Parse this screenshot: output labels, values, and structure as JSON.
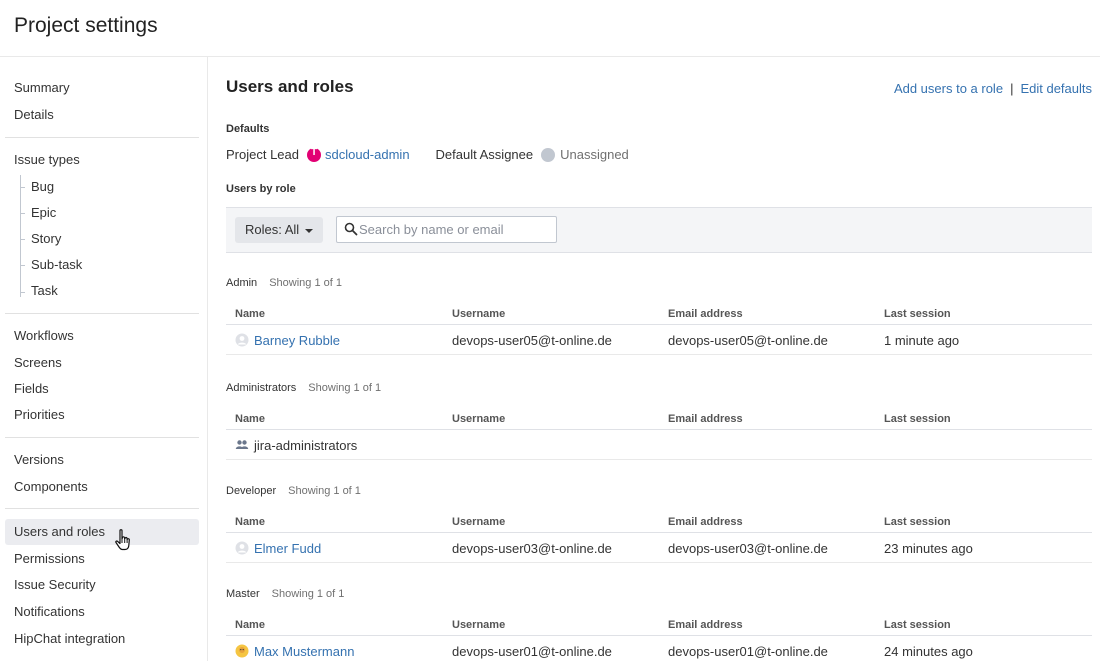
{
  "page_title": "Project settings",
  "sidebar": {
    "groups": [
      {
        "items": [
          {
            "label": "Summary"
          },
          {
            "label": "Details"
          }
        ]
      },
      {
        "items": [
          {
            "label": "Issue types"
          },
          {
            "label": "Bug"
          },
          {
            "label": "Epic"
          },
          {
            "label": "Story"
          },
          {
            "label": "Sub-task"
          },
          {
            "label": "Task"
          }
        ]
      },
      {
        "items": [
          {
            "label": "Workflows"
          },
          {
            "label": "Screens"
          },
          {
            "label": "Fields"
          },
          {
            "label": "Priorities"
          }
        ]
      },
      {
        "items": [
          {
            "label": "Versions"
          },
          {
            "label": "Components"
          }
        ]
      },
      {
        "items": [
          {
            "label": "Users and roles"
          },
          {
            "label": "Permissions"
          },
          {
            "label": "Issue Security"
          },
          {
            "label": "Notifications"
          },
          {
            "label": "HipChat integration"
          }
        ]
      }
    ]
  },
  "main": {
    "title": "Users and roles",
    "links": {
      "add": "Add users to a role",
      "edit": "Edit defaults"
    },
    "defaults_label": "Defaults",
    "project_lead_label": "Project Lead",
    "project_lead_value": "sdcloud-admin",
    "default_assignee_label": "Default Assignee",
    "default_assignee_value": "Unassigned",
    "users_by_role_label": "Users by role",
    "filter": {
      "roles_label": "Roles: All",
      "search_placeholder": "Search by name or email"
    },
    "columns": {
      "name": "Name",
      "username": "Username",
      "email": "Email address",
      "session": "Last session"
    },
    "roles": [
      {
        "name": "Admin",
        "count": "Showing 1 of 1",
        "row": {
          "name": "Barney Rubble",
          "username": "devops-user05@t-online.de",
          "email": "devops-user05@t-online.de",
          "session": "1 minute ago"
        }
      },
      {
        "name": "Administrators",
        "count": "Showing 1 of 1",
        "row": {
          "name": "jira-administrators",
          "username": "",
          "email": "",
          "session": ""
        }
      },
      {
        "name": "Developer",
        "count": "Showing 1 of 1",
        "row": {
          "name": "Elmer Fudd",
          "username": "devops-user03@t-online.de",
          "email": "devops-user03@t-online.de",
          "session": "23 minutes ago"
        }
      },
      {
        "name": "Master",
        "count": "Showing 1 of 1",
        "row": {
          "name": "Max Mustermann",
          "username": "devops-user01@t-online.de",
          "email": "devops-user01@t-online.de",
          "session": "24 minutes ago"
        }
      }
    ]
  },
  "icons": {
    "lead": "telekom-logo-icon",
    "assignee": "avatar-icon",
    "user": "user-avatar-icon",
    "group": "group-icon",
    "search": "search-icon",
    "cursor": "hand-pointer-icon"
  },
  "colors": {
    "link": "#3572b0",
    "lead_brand": "#e20074",
    "active_nav": "#ebecf0"
  }
}
